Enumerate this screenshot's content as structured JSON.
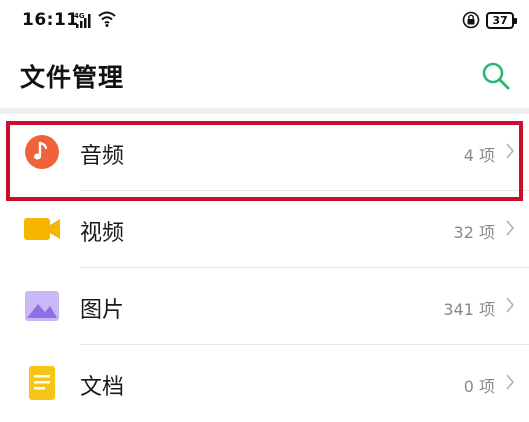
{
  "status_bar": {
    "time": "16:11",
    "network": "4G",
    "battery": "37"
  },
  "header": {
    "title": "文件管理",
    "search_icon": "search-icon",
    "accent_color": "#2bb673"
  },
  "categories": [
    {
      "label": "音频",
      "count": "4 项",
      "icon": "music-note-icon",
      "color": "#f0623a"
    },
    {
      "label": "视频",
      "count": "32 项",
      "icon": "video-camera-icon",
      "color": "#f7b500"
    },
    {
      "label": "图片",
      "count": "341 项",
      "icon": "image-icon",
      "color": "#a78bf0"
    },
    {
      "label": "文档",
      "count": "0 项",
      "icon": "document-icon",
      "color": "#f5c518"
    }
  ],
  "highlight_color": "#c8102e"
}
